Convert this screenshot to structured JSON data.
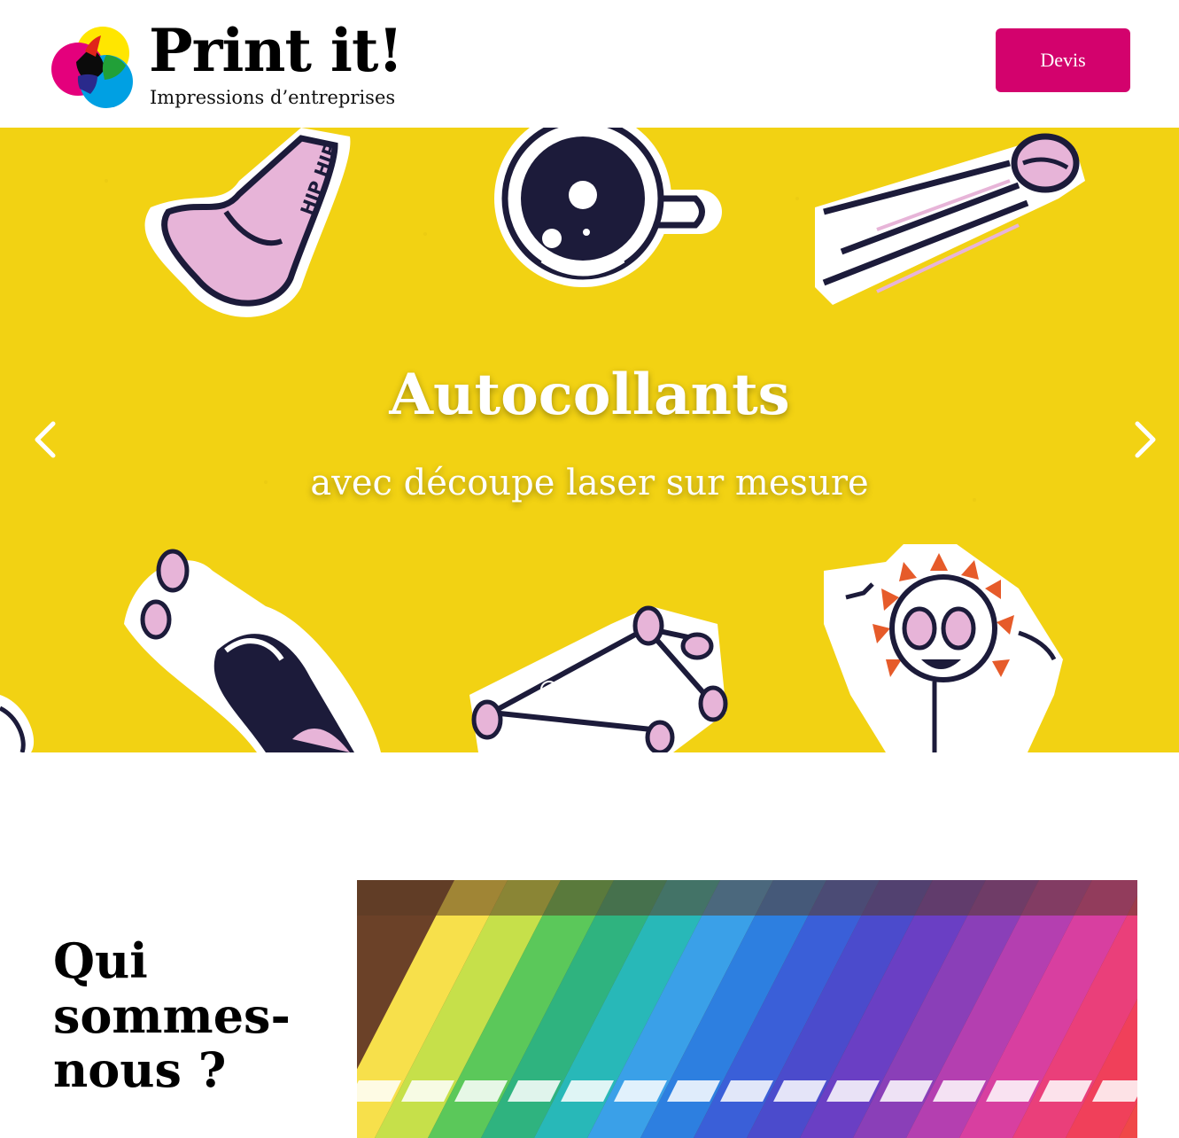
{
  "header": {
    "brand_title": "Print it!",
    "brand_subtitle": "Impressions d’entreprises",
    "devis_label": "Devis",
    "accent_color": "#d3026d"
  },
  "hero": {
    "background_color": "#f2d213",
    "title": "Autocollants",
    "subtitle": "avec découpe laser sur mesure",
    "prev_icon": "chevron-left-icon",
    "next_icon": "chevron-right-icon",
    "dots": [
      {
        "active": false
      },
      {
        "active": false
      },
      {
        "active": false
      },
      {
        "active": true
      }
    ]
  },
  "about": {
    "title": "Qui sommes-nous ?"
  }
}
